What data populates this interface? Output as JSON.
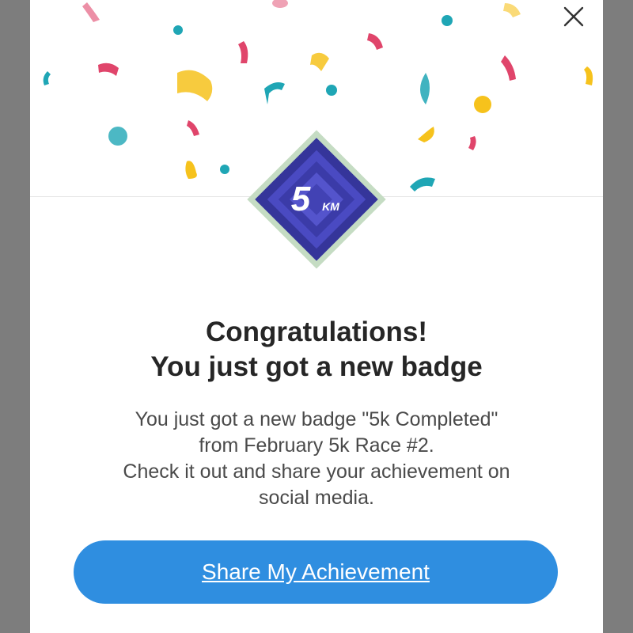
{
  "modal": {
    "title_line1": "Congratulations!",
    "title_line2": "You just got a new badge",
    "description_lines": [
      "You just got a new badge \"5k Completed\"",
      "from February 5k Race #2.",
      "Check it out and share your achievement on",
      "social media."
    ],
    "share_button_label": "Share My Achievement",
    "close_icon": "close-icon"
  },
  "badge": {
    "number": "5",
    "unit": "KM",
    "icon": "5km-badge-icon"
  },
  "colors": {
    "accent_button": "#2f8ee0",
    "badge_border": "#c5dcc3",
    "badge_fill": "#3f3fb0",
    "confetti_pink": "#e0456b",
    "confetti_teal": "#1fa6b5",
    "confetti_yellow": "#f6c21c"
  }
}
